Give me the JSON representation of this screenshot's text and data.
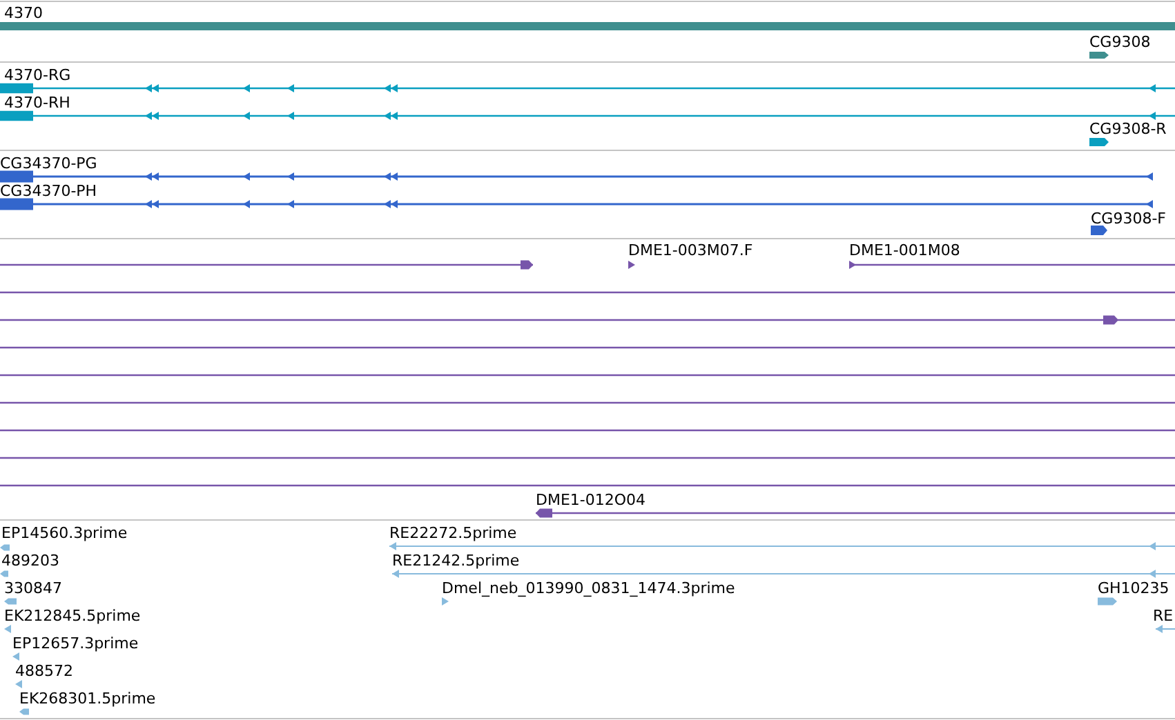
{
  "tracks": [
    {
      "kind": "gene",
      "color": "#3f8f8f",
      "features": [
        {
          "label": "4370",
          "kind": "bar"
        },
        {
          "label": "CG9308",
          "kind": "arrow",
          "forward": true
        }
      ]
    },
    {
      "kind": "transcript",
      "color": "#0a9fc0",
      "features": [
        {
          "label": "4370-RG",
          "kind": "arrow",
          "forward": false
        },
        {
          "label": "4370-RH",
          "kind": "arrow",
          "forward": false
        },
        {
          "label": "CG9308-R",
          "kind": "arrow",
          "forward": true
        }
      ]
    },
    {
      "kind": "protein",
      "color": "#3366cc",
      "features": [
        {
          "label": "CG34370-PG",
          "kind": "arrow",
          "forward": false
        },
        {
          "label": "CG34370-PH",
          "kind": "arrow",
          "forward": false
        },
        {
          "label": "CG9308-F",
          "kind": "arrow",
          "forward": true
        }
      ]
    },
    {
      "kind": "clone",
      "color": "#7755aa",
      "features": [
        {
          "kind": "arrow",
          "forward": true
        },
        {
          "label": "DME1-003M07.F",
          "kind": "arrow",
          "forward": true
        },
        {
          "label": "DME1-001M08",
          "kind": "arrow",
          "forward": true
        },
        {
          "kind": "line"
        },
        {
          "kind": "arrow",
          "forward": true
        },
        {
          "kind": "line"
        },
        {
          "kind": "line"
        },
        {
          "kind": "line"
        },
        {
          "kind": "line"
        },
        {
          "kind": "line"
        },
        {
          "kind": "line"
        },
        {
          "label": "DME1-012O04",
          "kind": "arrow",
          "forward": false
        }
      ]
    },
    {
      "kind": "est",
      "color": "#88bbdd",
      "features": [
        {
          "label": "EP14560.3prime",
          "kind": "arrow",
          "forward": false
        },
        {
          "label": "489203",
          "kind": "arrow",
          "forward": false
        },
        {
          "label": "330847",
          "kind": "arrow",
          "forward": false
        },
        {
          "label": "EK212845.5prime",
          "kind": "arrow",
          "forward": false
        },
        {
          "label": "EP12657.3prime",
          "kind": "arrow",
          "forward": false
        },
        {
          "label": "488572",
          "kind": "arrow",
          "forward": false
        },
        {
          "label": "EK268301.5prime",
          "kind": "arrow",
          "forward": false
        },
        {
          "label": "RE22272.5prime",
          "kind": "arrow",
          "forward": false
        },
        {
          "label": "RE21242.5prime",
          "kind": "arrow",
          "forward": false
        },
        {
          "label": "Dmel_neb_013990_0831_1474.3prime",
          "kind": "arrow",
          "forward": true
        },
        {
          "label": "GH10235",
          "kind": "arrow",
          "forward": true
        },
        {
          "label": "RE",
          "kind": "arrow",
          "forward": false
        }
      ]
    }
  ]
}
